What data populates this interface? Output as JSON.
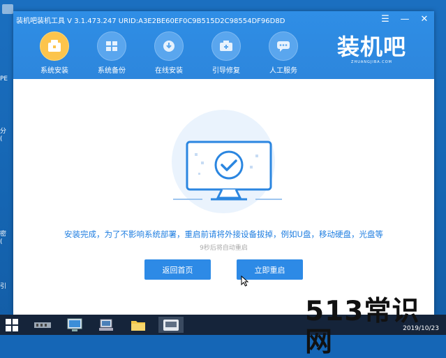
{
  "window": {
    "title": "装机吧装机工具 V 3.1.473.247 URID:A3E2BE60EF0C9B515D2C98554DF96D8D"
  },
  "window_controls": {
    "menu": "☰",
    "minimize": "—",
    "close": "✕"
  },
  "tabs": [
    {
      "label": "系统安装",
      "active": true
    },
    {
      "label": "系统备份",
      "active": false
    },
    {
      "label": "在线安装",
      "active": false
    },
    {
      "label": "引导修复",
      "active": false
    },
    {
      "label": "人工服务",
      "active": false
    }
  ],
  "logo": {
    "main": "装机吧",
    "sub": "ZHUANGJIBA.COM"
  },
  "message": "安装完成，为了不影响系统部署，重启前请将外接设备拔掉，例如U盘，移动硬盘，光盘等",
  "countdown": "9秒后将自动重启",
  "buttons": {
    "home": "返回首页",
    "restart": "立即重启"
  },
  "desktop_items": [
    "PE",
    "分\n(",
    "",
    "密\n(",
    "引"
  ],
  "taskbar": {
    "date": "2019/10/23"
  },
  "watermark": "513常识网",
  "colors": {
    "accent": "#2d8ae6",
    "active_tab": "#fcc44c",
    "message": "#1f7ee0"
  }
}
